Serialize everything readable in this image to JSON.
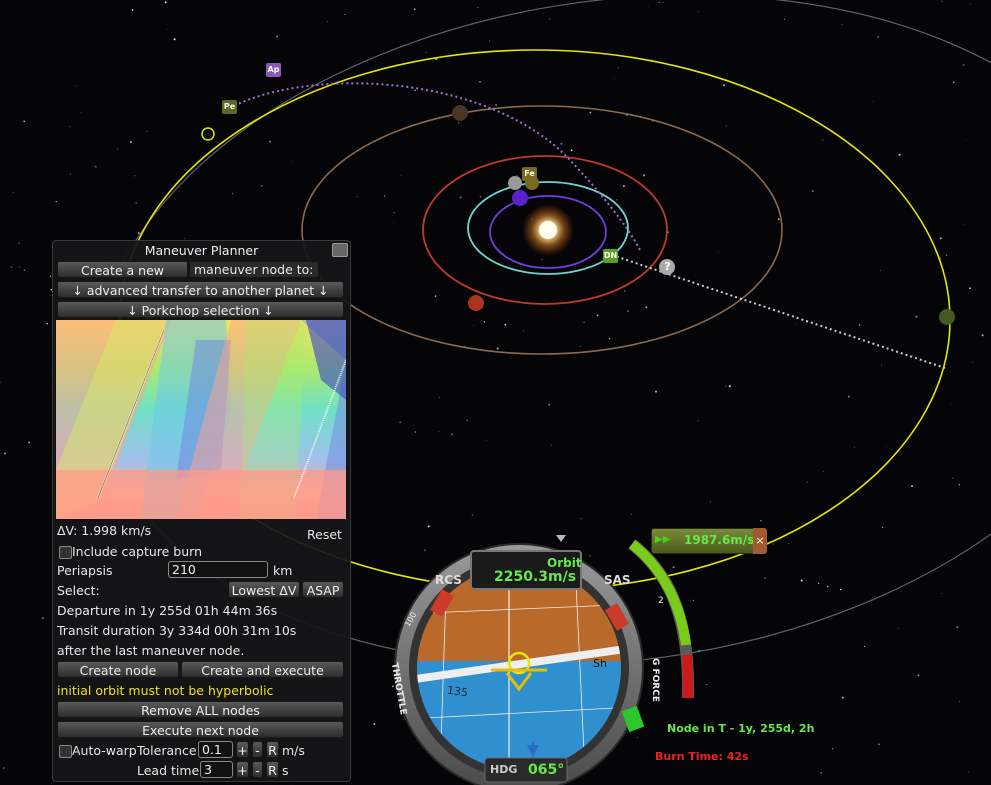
{
  "planner": {
    "title": "Maneuver Planner",
    "create_new_button": "Create a new",
    "create_new_suffix": "maneuver node to:",
    "transfer_dropdown": "↓ advanced transfer to another planet ↓",
    "porkchop_dropdown": "↓ Porkchop selection ↓",
    "delta_v": "ΔV: 1.998 km/s",
    "reset_button": "Reset",
    "capture_burn_label": "Include capture burn",
    "capture_burn_checked": false,
    "periapsis_label": "Periapsis",
    "periapsis_value": "210",
    "periapsis_unit": "km",
    "select_label": "Select:",
    "lowest_dv_button": "Lowest ΔV",
    "asap_button": "ASAP",
    "departure_text": "Departure in 1y 255d 01h 44m 36s",
    "transit_text": "Transit duration 3y 334d 00h 31m 10s",
    "after_text": "after the last maneuver node.",
    "create_node_button": "Create node",
    "create_execute_button": "Create and execute",
    "warning_text": "initial orbit must not be hyperbolic",
    "remove_all_button": "Remove ALL nodes",
    "execute_next_button": "Execute next node",
    "autowarp_label": "Auto-warp",
    "autowarp_checked": false,
    "tolerance_label": "Tolerance:",
    "tolerance_value": "0.1",
    "plus": "+",
    "minus": "-",
    "reset_r": "R",
    "tolerance_unit": "m/s",
    "lead_time_label": "Lead time:",
    "lead_time_value": "3",
    "lead_time_unit": "s"
  },
  "map_markers": {
    "ap": "Ap",
    "pe": "Pe",
    "fe": "Fe",
    "dn": "DN",
    "unknown": "?"
  },
  "navball": {
    "mode": "Orbit",
    "speed": "2250.3m/s",
    "rcs": "RCS",
    "sas": "SAS",
    "throttle": "THROTTLE",
    "gforce": "G FORCE",
    "hdg_label": "HDG",
    "heading": "065°",
    "gauge_100": "100",
    "gauge_2": "2",
    "tick_135": "135",
    "tick_sh": "Sh"
  },
  "node_widget": {
    "delta_v": "1987.6m/s",
    "close": "×"
  },
  "node_info": {
    "node_in": "Node in T - 1y, 255d, 2h",
    "burn_time": "Burn Time: 42s"
  },
  "colors": {
    "sun": "#fff6d0",
    "yellow_orbit": "#e6e600",
    "speed_green": "#66e84a",
    "warning_yellow": "#f0e020",
    "burn_red": "#e22222"
  }
}
